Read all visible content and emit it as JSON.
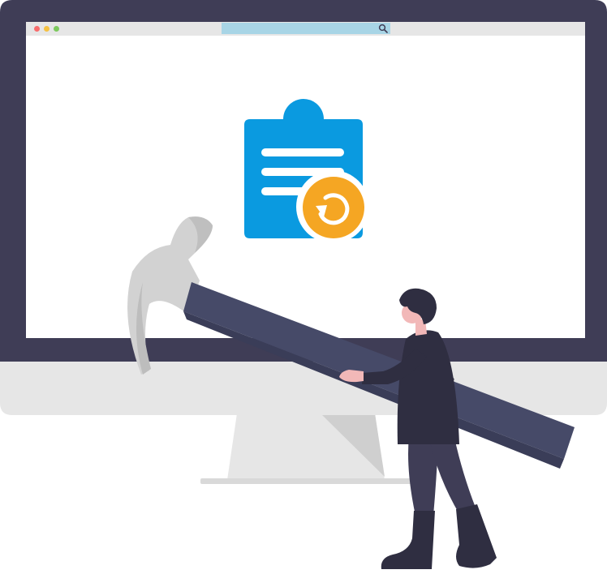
{
  "browser": {
    "address_text": "",
    "icons": [
      "close-dot",
      "minimize-dot",
      "maximize-dot",
      "search-icon"
    ]
  },
  "illustration": {
    "icons": [
      "clipboard-icon",
      "restore-icon",
      "hammer",
      "person"
    ]
  },
  "colors": {
    "monitor_frame": "#3f3d56",
    "monitor_stand": "#e6e6e6",
    "browser_bar": "#e6e6e6",
    "address_bar": "#a8d5e6",
    "dot_close": "#f86c6c",
    "dot_minimize": "#f5c142",
    "dot_maximize": "#7dc95e",
    "clipboard": "#0a9ae0",
    "restore_badge": "#f5a623",
    "hammer_handle": "#464a68",
    "hammer_head": "#d2d2d2",
    "skin": "#f2b8b8",
    "clothing": "#2f2e41"
  }
}
